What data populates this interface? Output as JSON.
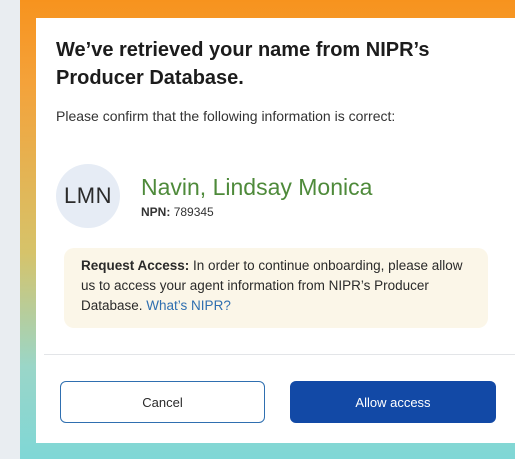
{
  "dialog": {
    "title": "We’ve retrieved your name from NIPR’s Producer Database.",
    "subtitle": "Please confirm that the following information is correct:"
  },
  "producer": {
    "initials": "LMN",
    "name": "Navin, Lindsay Monica",
    "npn_label": "NPN:",
    "npn_value": "789345"
  },
  "notice": {
    "lead": "Request Access:",
    "body": " In order to continue onboarding, please allow us to access your agent information from NIPR’s Producer Database. ",
    "link": "What’s NIPR?"
  },
  "actions": {
    "cancel_label": "Cancel",
    "allow_label": "Allow access"
  },
  "colors": {
    "name_green": "#4e8a3a",
    "primary_blue": "#1249a6",
    "link_blue": "#2f6fb0",
    "notice_bg": "#fbf6e8",
    "frame_orange": "#f7931e",
    "frame_teal": "#7fd7d6"
  }
}
